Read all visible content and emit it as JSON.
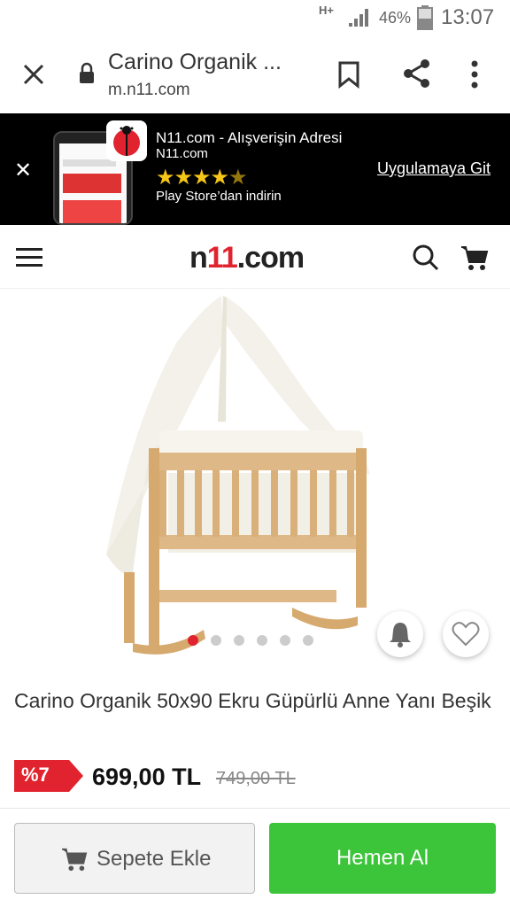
{
  "status_bar": {
    "network": "H+",
    "battery": "46%",
    "time": "13:07"
  },
  "browser": {
    "title": "Carino Organik ...",
    "url": "m.n11.com"
  },
  "app_banner": {
    "app_name": "N11.com - Alışverişin Adresi",
    "domain": "N11.com",
    "rating_stars": 4.5,
    "store_text": "Play Store’dan indirin",
    "open_app_label": "Uygulamaya Git"
  },
  "site_header": {
    "logo_prefix": "n",
    "logo_accent": "11",
    "logo_suffix": ".com"
  },
  "product": {
    "title": "Carino Organik 50x90 Ekru Güpürlü Anne Yanı Beşik",
    "discount": "%7",
    "price": "699,00 TL",
    "old_price": "749,00 TL",
    "image_count": 6,
    "active_image": 1
  },
  "actions": {
    "add_to_cart": "Sepete Ekle",
    "buy_now": "Hemen Al"
  },
  "colors": {
    "brand_red": "#e0232e",
    "buy_green": "#3cc43a",
    "star": "#f5c518"
  }
}
